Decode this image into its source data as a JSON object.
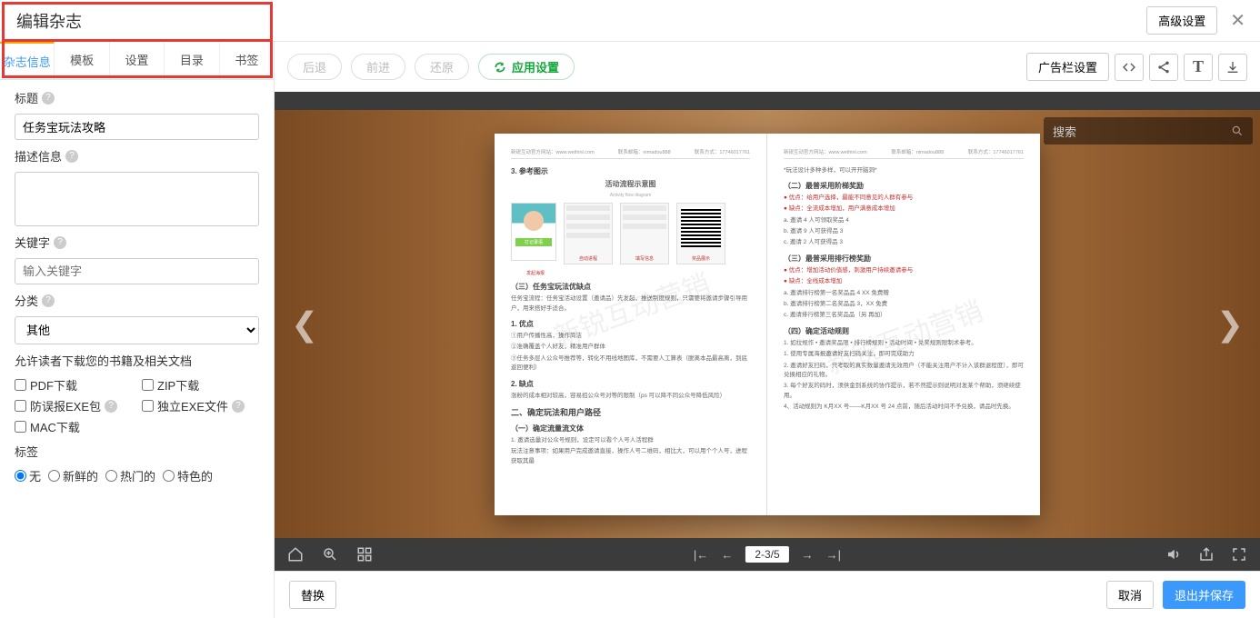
{
  "header": {
    "title": "编辑杂志",
    "adv": "高级设置"
  },
  "tabs": [
    "杂志信息",
    "模板",
    "设置",
    "目录",
    "书签"
  ],
  "form": {
    "title_label": "标题",
    "title_value": "任务宝玩法攻略",
    "desc_label": "描述信息",
    "kw_label": "关键字",
    "kw_ph": "输入关键字",
    "cat_label": "分类",
    "cat_value": "其他",
    "dl_label": "允许读者下载您的书籍及相关文档",
    "dl": {
      "pdf": "PDF下载",
      "zip": "ZIP下载",
      "exe1": "防误报EXE包",
      "exe2": "独立EXE文件",
      "mac": "MAC下载"
    },
    "tag_label": "标签",
    "tags": {
      "none": "无",
      "fresh": "新鲜的",
      "hot": "热门的",
      "feat": "特色的"
    }
  },
  "toolbar": {
    "back": "后退",
    "fwd": "前进",
    "restore": "还原",
    "apply": "应用设置",
    "adbar": "广告栏设置"
  },
  "search_ph": "搜索",
  "viewer": {
    "page": "2-3/5"
  },
  "footer": {
    "replace": "替换",
    "cancel": "取消",
    "save": "退出并保存"
  },
  "book": {
    "hdr_left": "新锐互动官方网站：www.wethinl.com",
    "hdr_mid": "联系邮箱：nimadou888",
    "hdr_right": "联系方式：17746017761",
    "wm": "新锐互动营销",
    "left": {
      "sec1": "3. 参考图示",
      "flow_title": "活动流程示意图",
      "flow_sub": "Activity flow diagram",
      "caps": [
        "发起海报",
        "自动进程",
        "填写信息",
        "奖品展示"
      ],
      "sec2": "（三）任务宝玩法优缺点",
      "p1": "任务宝流程：任务宝活动设置（邀请品）先发起，推送制度规则，只需要将邀请步骤引导用户，用来搭好手适合。",
      "h1": "1. 优点",
      "o1": "①用户传播性高，操作简洁",
      "o2": "②准确覆盖个人好友，精准用户群体",
      "o3": "③任务多层人公众号推荐等，转化不用线地图库，不需要人工算表（脱离本品最高离，到底返回便利）",
      "h2": "2. 缺点",
      "o4": "涨粉的成本相对较高，容易招公众号对等的限制（ps 可以降不同公众号降低风险）",
      "sec3": "二、确定玩法和用户路径",
      "sub3": "（一）确定流量流文体",
      "p2": "1. 邀请选量对公众号规则，设定可以看个人号人活程群",
      "p3": "玩法注意事项：如果用户完成邀请直接，操作人号二维码，相比大，可以用个个人号，进程获取其最"
    },
    "right": {
      "top": "*玩法设计多种多样，可以开开脑洞*",
      "sec1": "（二）最普采用阶梯奖励",
      "r1": "优点：给用户选择，最能不同意见的人群有参与",
      "r2": "缺点：全流成本增加，用户满意成本增加",
      "a": "a. 邀请 4 人可领取奖品 4",
      "b": "b. 邀请 9 人可获得品 3",
      "c": "c. 邀请 2 人可获得品 3",
      "sec2": "（三）最普采用排行榜奖励",
      "r3": "优点：增加活动价值感，刺激用户持续邀请参与",
      "r4": "缺点：全线成本增加",
      "d": "a. 邀请排行榜第一名奖品品 4 XX 免费赠",
      "e": "b. 邀请排行榜第二名奖品品 3，XX 免费",
      "f": "c. 邀请排行榜第三名奖品品（另 再加）",
      "sec3": "（四）确定活动规则",
      "p1": "1. 如拉规作 • 邀请奖品限 • 排行榜规则 • 活动时间 • 兑奖规则限制术参考。",
      "p2": "1. 使用专属海报邀请好友扫码关注，即可完成助力",
      "p3": "2. 邀请好友扫码，只考取的真实数量邀请无效用户（不能关注用户不计入该群退程度），即可兑换相应的礼物。",
      "p4": "3. 每个好友的码时，须供金到系统的协作提示，若不然提示则说明对发某个帮助，须继续使用。",
      "p5": "4、活动规则为 K月XX 号——K月XX 号 24 点前，随后活动时间不予兑换，请品时先换。"
    }
  }
}
